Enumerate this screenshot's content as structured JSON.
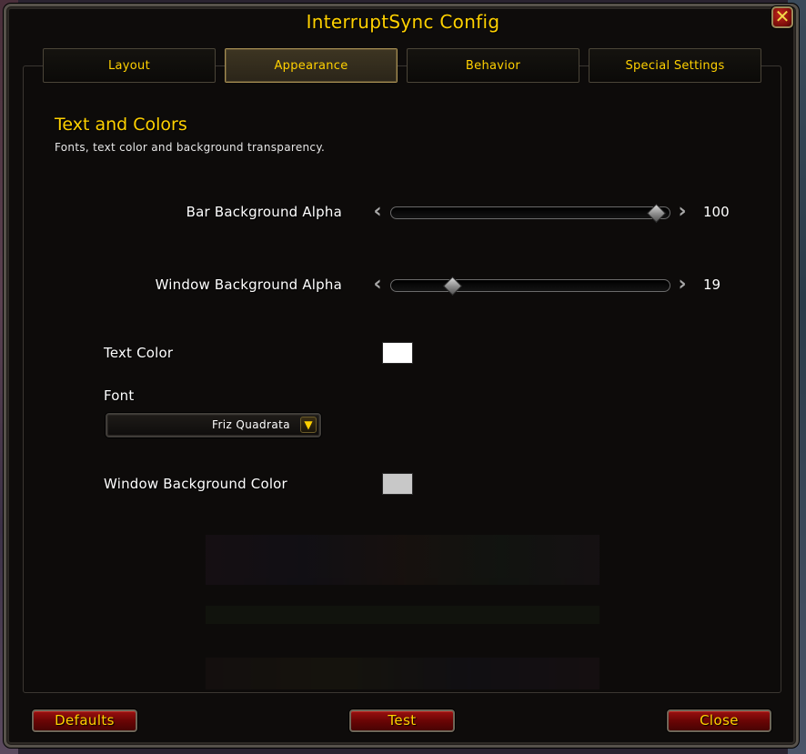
{
  "window": {
    "title": "InterruptSync Config"
  },
  "tabs": [
    {
      "label": "Layout"
    },
    {
      "label": "Appearance"
    },
    {
      "label": "Behavior"
    },
    {
      "label": "Special Settings"
    }
  ],
  "active_tab": "Appearance",
  "section": {
    "title": "Text and Colors",
    "description": "Fonts, text color and background transparency."
  },
  "settings": {
    "bar_bg_alpha": {
      "label": "Bar Background Alpha",
      "value": "100",
      "fraction": 1.0
    },
    "window_bg_alpha": {
      "label": "Window Background Alpha",
      "value": "19",
      "fraction": 0.19
    },
    "text_color": {
      "label": "Text Color",
      "color": "#ffffff"
    },
    "font": {
      "label": "Font",
      "value": "Friz Quadrata"
    },
    "window_bg_color": {
      "label": "Window Background Color",
      "color": "#c8c8c8"
    }
  },
  "buttons": {
    "defaults": "Defaults",
    "test": "Test",
    "close": "Close"
  },
  "icons": {
    "close": "close-icon",
    "slider_left": "chevron-left-icon",
    "slider_right": "chevron-right-icon",
    "dropdown": "chevron-down-icon"
  },
  "colors": {
    "accent": "#ffd100",
    "button": "#7a0808"
  }
}
